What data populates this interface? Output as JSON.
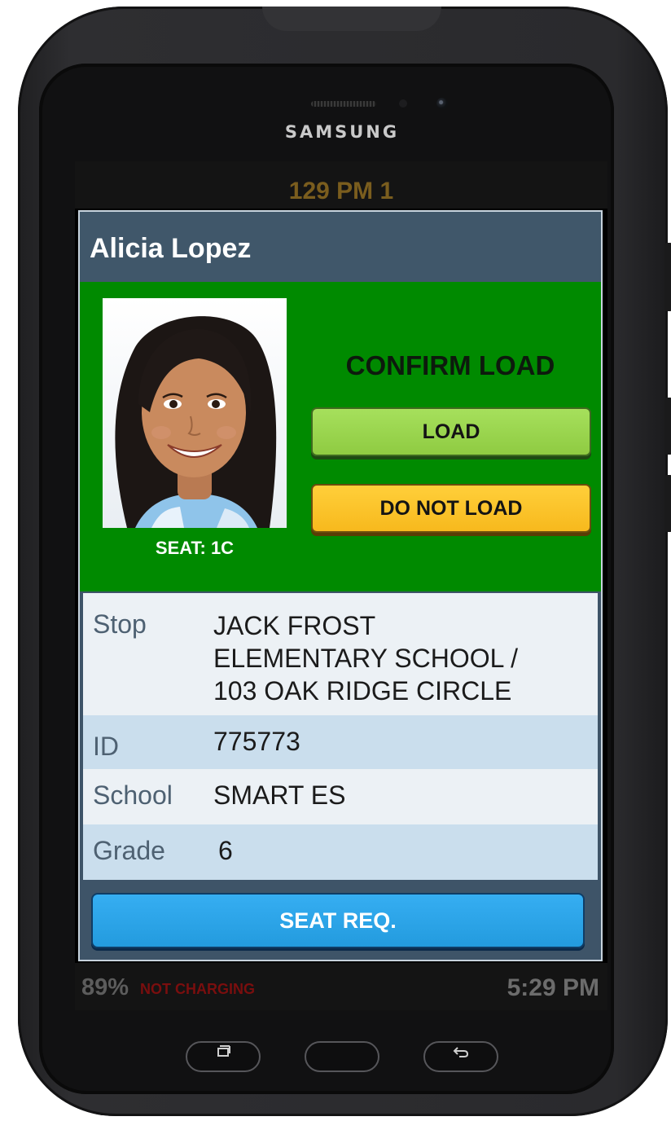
{
  "device": {
    "brand": "SAMSUNG"
  },
  "top_status": {
    "text": "129 PM 1"
  },
  "student": {
    "name": "Alicia Lopez",
    "seat": "SEAT: 1C"
  },
  "confirm": {
    "title": "CONFIRM LOAD",
    "load_label": "LOAD",
    "do_not_load_label": "DO NOT LOAD"
  },
  "info": {
    "stop_label": "Stop",
    "stop_lines": [
      "JACK FROST",
      "ELEMENTARY SCHOOL /",
      "103 OAK RIDGE CIRCLE"
    ],
    "id_label": "ID",
    "id_value": "775773",
    "school_label": "School",
    "school_value": "SMART ES",
    "grade_label": "Grade",
    "grade_value": "6"
  },
  "seat_request": {
    "label": "SEAT REQ."
  },
  "bottom_status": {
    "battery": "89%",
    "charging": "NOT CHARGING",
    "time": "5:29 PM"
  },
  "nav": {
    "recent_icon": "recent-apps-icon",
    "home_icon": "home-icon",
    "back_icon": "back-icon"
  },
  "colors": {
    "header_bg": "#40576a",
    "panel_green": "#008a00",
    "load_green": "#9ad64e",
    "do_not_load_yellow": "#f9c22a",
    "seat_req_blue": "#2ba5ea",
    "row_light": "#ecf1f5",
    "row_blue": "#cadeed",
    "charging_red": "#7a0e0e"
  }
}
